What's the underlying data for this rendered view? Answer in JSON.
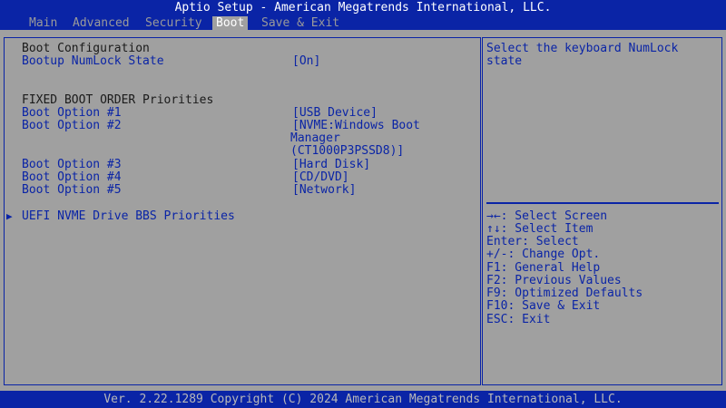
{
  "title": "Aptio Setup - American Megatrends International, LLC.",
  "tabs": [
    "Main",
    "Advanced",
    "Security",
    "Boot",
    "Save & Exit"
  ],
  "active_tab": "Boot",
  "boot_config_header": "Boot Configuration",
  "numlock": {
    "label": "Bootup NumLock State",
    "value": "[On]"
  },
  "fixed_order_header": "FIXED BOOT ORDER Priorities",
  "boot_options": [
    {
      "label": "Boot Option #1",
      "value": [
        "[USB Device]"
      ]
    },
    {
      "label": "Boot Option #2",
      "value": [
        "[NVME:Windows Boot",
        "Manager",
        "(CT1000P3PSSD8)]"
      ]
    },
    {
      "label": "Boot Option #3",
      "value": [
        "[Hard Disk]"
      ]
    },
    {
      "label": "Boot Option #4",
      "value": [
        "[CD/DVD]"
      ]
    },
    {
      "label": "Boot Option #5",
      "value": [
        "[Network]"
      ]
    }
  ],
  "submenu": {
    "arrow": "▶",
    "label": "UEFI NVME Drive BBS Priorities"
  },
  "help_text": [
    "Select the keyboard NumLock",
    "state"
  ],
  "key_help": [
    "→←: Select Screen",
    "↑↓: Select Item",
    "Enter: Select",
    "+/-: Change Opt.",
    "F1: General Help",
    "F2: Previous Values",
    "F9: Optimized Defaults",
    "F10: Save & Exit",
    "ESC: Exit"
  ],
  "footer": "Ver. 2.22.1289 Copyright (C) 2024 American Megatrends International, LLC.",
  "colors": {
    "blue": "#0a24a6",
    "gray": "#a0a0a0",
    "white": "#ffffff"
  }
}
